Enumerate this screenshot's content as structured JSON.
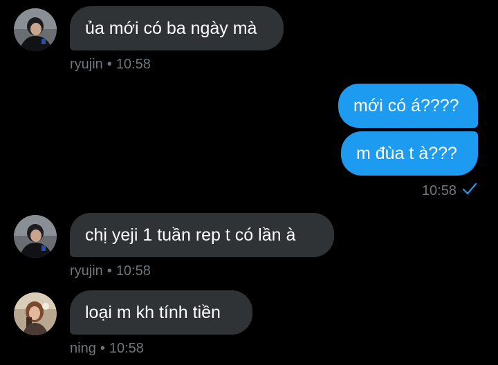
{
  "messages": [
    {
      "sender": "ryujin",
      "text": "ủa mới có ba ngày mà",
      "time": "10:58"
    },
    {
      "sender": "me",
      "text": "mới có á????"
    },
    {
      "sender": "me",
      "text": "m đùa t à???",
      "time": "10:58",
      "status": "sent-check"
    },
    {
      "sender": "ryujin",
      "text": "chị yeji 1 tuần rep t có lần à",
      "time": "10:58"
    },
    {
      "sender": "ning",
      "text": "loại m kh tính tiền",
      "time": "10:58"
    }
  ],
  "meta_separator": "•",
  "colors": {
    "background": "#000000",
    "incoming_bubble": "#2f3336",
    "outgoing_bubble": "#1d9bf0",
    "meta_text": "#71767b",
    "check": "#1d9bf0"
  },
  "icons": {
    "read_status": "check-icon",
    "avatar_ryujin": "avatar-ryujin",
    "avatar_ning": "avatar-ning"
  }
}
